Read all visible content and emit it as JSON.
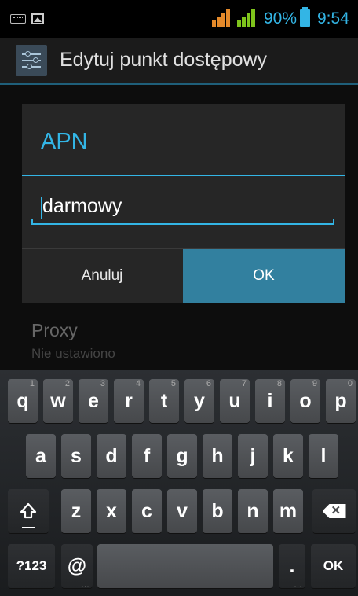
{
  "status_bar": {
    "battery_percent": "90%",
    "time": "9:54",
    "colors": {
      "accent": "#33b5e5",
      "signal_orange": "#e58a2a",
      "signal_green": "#7fc41c"
    },
    "icons": [
      "keyboard-notification-icon",
      "image-notification-icon",
      "signal-icon",
      "signal-icon",
      "battery-icon"
    ]
  },
  "action_bar": {
    "title": "Edytuj punkt dostępowy",
    "icon": "settings-sliders-icon"
  },
  "background_item": {
    "title": "Proxy",
    "subtitle": "Nie ustawiono"
  },
  "dialog": {
    "title": "APN",
    "input_value": "darmowy",
    "cancel_label": "Anuluj",
    "ok_label": "OK",
    "colors": {
      "accent": "#33b5e5",
      "ok_bg": "#32809f"
    }
  },
  "keyboard": {
    "row1": [
      {
        "label": "q",
        "hint": "1"
      },
      {
        "label": "w",
        "hint": "2"
      },
      {
        "label": "e",
        "hint": "3"
      },
      {
        "label": "r",
        "hint": "4"
      },
      {
        "label": "t",
        "hint": "5"
      },
      {
        "label": "y",
        "hint": "6"
      },
      {
        "label": "u",
        "hint": "7"
      },
      {
        "label": "i",
        "hint": "8"
      },
      {
        "label": "o",
        "hint": "9"
      },
      {
        "label": "p",
        "hint": "0"
      }
    ],
    "row2": [
      "a",
      "s",
      "d",
      "f",
      "g",
      "h",
      "j",
      "k",
      "l"
    ],
    "row3": [
      "z",
      "x",
      "c",
      "v",
      "b",
      "n",
      "m"
    ],
    "symbols_label": "?123",
    "at_label": "@",
    "period_label": ".",
    "ok_label": "OK",
    "icons": {
      "shift": "shift-icon",
      "backspace": "backspace-icon"
    }
  }
}
